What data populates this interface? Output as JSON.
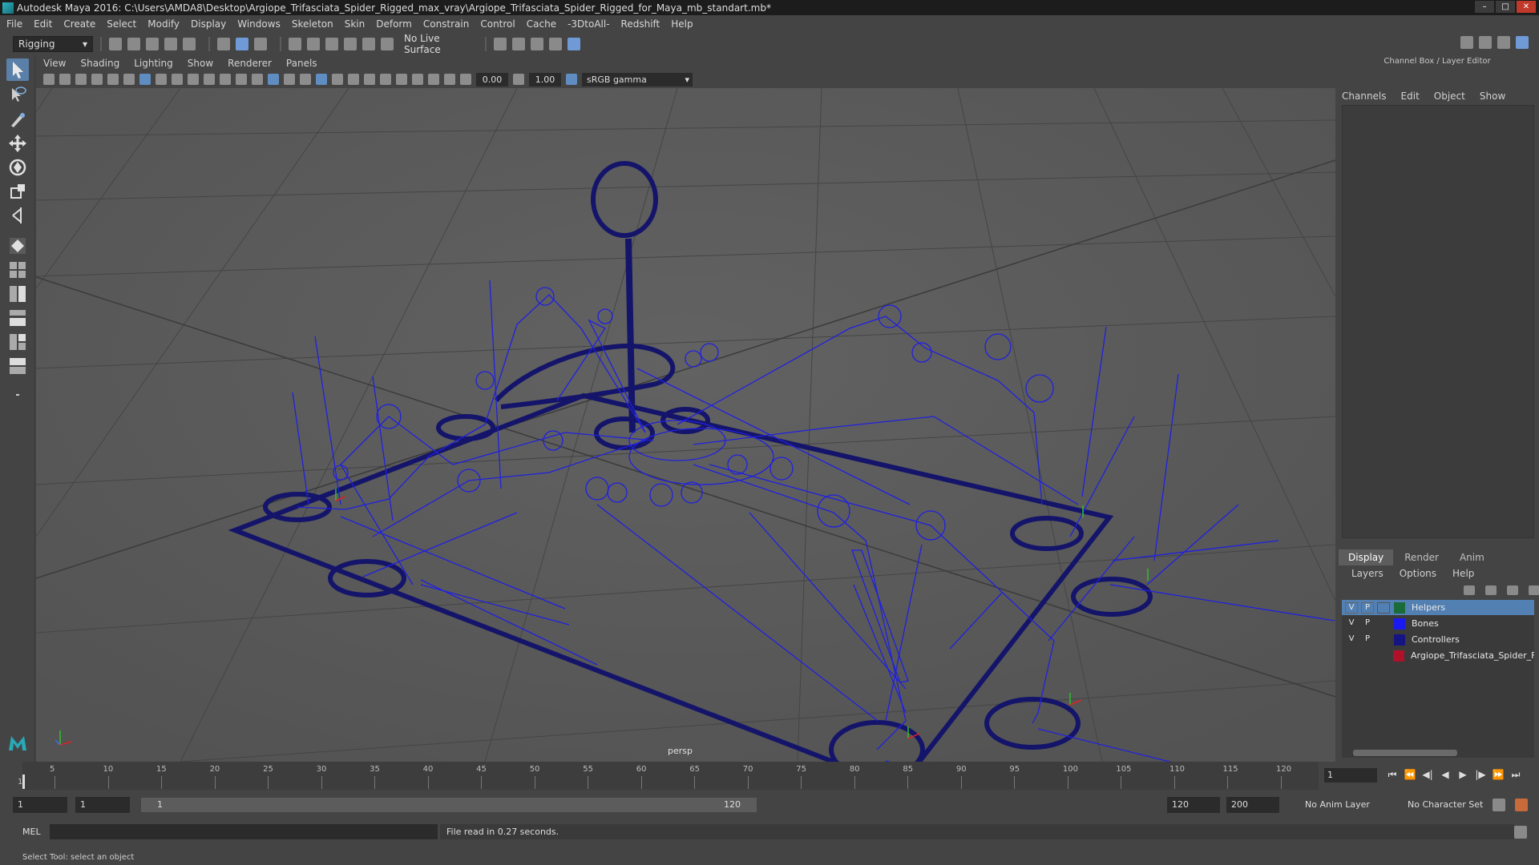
{
  "window": {
    "title": "Autodesk Maya 2016: C:\\Users\\AMDA8\\Desktop\\Argiope_Trifasciata_Spider_Rigged_max_vray\\Argiope_Trifasciata_Spider_Rigged_for_Maya_mb_standart.mb*"
  },
  "menus": [
    "File",
    "Edit",
    "Create",
    "Select",
    "Modify",
    "Display",
    "Windows",
    "Skeleton",
    "Skin",
    "Deform",
    "Constrain",
    "Control",
    "Cache",
    "-3DtoAll-",
    "Redshift",
    "Help"
  ],
  "shelf": {
    "mode": "Rigging",
    "live_surface": "No Live Surface"
  },
  "panel_menus": [
    "View",
    "Shading",
    "Lighting",
    "Show",
    "Renderer",
    "Panels"
  ],
  "panel_toolbar": {
    "exposure": "0.00",
    "gamma": "1.00",
    "color_space": "sRGB gamma"
  },
  "viewport": {
    "camera": "persp",
    "wire_color": "#1e1ecf",
    "controller_color": "#14146a"
  },
  "channel_box": {
    "header": "Channel Box / Layer Editor",
    "menus": [
      "Channels",
      "Edit",
      "Object",
      "Show"
    ]
  },
  "layer_editor": {
    "tabs": [
      "Display",
      "Render",
      "Anim"
    ],
    "active_tab": "Display",
    "menus": [
      "Layers",
      "Options",
      "Help"
    ],
    "layers": [
      {
        "name": "Helpers",
        "v": "V",
        "p": "P",
        "color": "#1a6b3a",
        "selected": true
      },
      {
        "name": "Bones",
        "v": "V",
        "p": "P",
        "color": "#1a1af0",
        "selected": false
      },
      {
        "name": "Controllers",
        "v": "V",
        "p": "P",
        "color": "#141482",
        "selected": false
      },
      {
        "name": "Argiope_Trifasciata_Spider_F",
        "v": "",
        "p": "",
        "color": "#b0102a",
        "selected": false
      }
    ]
  },
  "timeline": {
    "ticks": [
      "5",
      "10",
      "15",
      "20",
      "25",
      "30",
      "35",
      "40",
      "45",
      "50",
      "55",
      "60",
      "65",
      "70",
      "75",
      "80",
      "85",
      "90",
      "95",
      "100",
      "105",
      "110",
      "115",
      "120"
    ],
    "current_frame": "1",
    "ruler_start_label": "1"
  },
  "range": {
    "start": "1",
    "anim_start": "1",
    "slider_start": "1",
    "slider_end": "120",
    "anim_end": "120",
    "end": "200",
    "anim_layer": "No Anim Layer",
    "character_set": "No Character Set"
  },
  "command": {
    "mode": "MEL",
    "result": "File read in  0.27 seconds."
  },
  "help_line": "Select Tool: select an object"
}
